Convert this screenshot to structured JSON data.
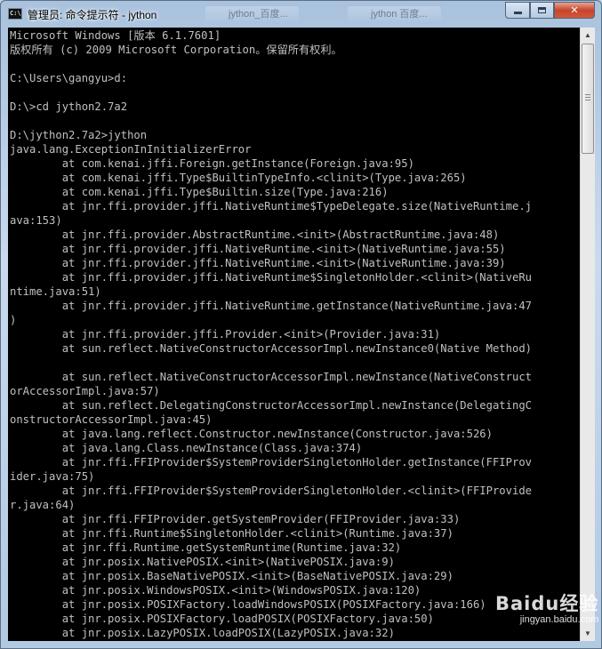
{
  "window": {
    "title": "管理员: 命令提示符 - jython",
    "app_icon_text": "C:\\",
    "background_tabs": [
      "jython_百度...",
      "jython 百度..."
    ]
  },
  "console": {
    "lines": [
      "Microsoft Windows [版本 6.1.7601]",
      "版权所有 (c) 2009 Microsoft Corporation。保留所有权利。",
      "",
      "C:\\Users\\gangyu>d:",
      "",
      "D:\\>cd jython2.7a2",
      "",
      "D:\\jython2.7a2>jython",
      "java.lang.ExceptionInInitializerError",
      "        at com.kenai.jffi.Foreign.getInstance(Foreign.java:95)",
      "        at com.kenai.jffi.Type$BuiltinTypeInfo.<clinit>(Type.java:265)",
      "        at com.kenai.jffi.Type$Builtin.size(Type.java:216)",
      "        at jnr.ffi.provider.jffi.NativeRuntime$TypeDelegate.size(NativeRuntime.j",
      "ava:153)",
      "        at jnr.ffi.provider.AbstractRuntime.<init>(AbstractRuntime.java:48)",
      "        at jnr.ffi.provider.jffi.NativeRuntime.<init>(NativeRuntime.java:55)",
      "        at jnr.ffi.provider.jffi.NativeRuntime.<init>(NativeRuntime.java:39)",
      "        at jnr.ffi.provider.jffi.NativeRuntime$SingletonHolder.<clinit>(NativeRu",
      "ntime.java:51)",
      "        at jnr.ffi.provider.jffi.NativeRuntime.getInstance(NativeRuntime.java:47",
      ")",
      "        at jnr.ffi.provider.jffi.Provider.<init>(Provider.java:31)",
      "        at sun.reflect.NativeConstructorAccessorImpl.newInstance0(Native Method)",
      "",
      "        at sun.reflect.NativeConstructorAccessorImpl.newInstance(NativeConstruct",
      "orAccessorImpl.java:57)",
      "        at sun.reflect.DelegatingConstructorAccessorImpl.newInstance(DelegatingC",
      "onstructorAccessorImpl.java:45)",
      "        at java.lang.reflect.Constructor.newInstance(Constructor.java:526)",
      "        at java.lang.Class.newInstance(Class.java:374)",
      "        at jnr.ffi.FFIProvider$SystemProviderSingletonHolder.getInstance(FFIProv",
      "ider.java:75)",
      "        at jnr.ffi.FFIProvider$SystemProviderSingletonHolder.<clinit>(FFIProvide",
      "r.java:64)",
      "        at jnr.ffi.FFIProvider.getSystemProvider(FFIProvider.java:33)",
      "        at jnr.ffi.Runtime$SingletonHolder.<clinit>(Runtime.java:37)",
      "        at jnr.ffi.Runtime.getSystemRuntime(Runtime.java:32)",
      "        at jnr.posix.NativePOSIX.<init>(NativePOSIX.java:9)",
      "        at jnr.posix.BaseNativePOSIX.<init>(BaseNativePOSIX.java:29)",
      "        at jnr.posix.WindowsPOSIX.<init>(WindowsPOSIX.java:120)",
      "        at jnr.posix.POSIXFactory.loadWindowsPOSIX(POSIXFactory.java:166)",
      "        at jnr.posix.POSIXFactory.loadPOSIX(POSIXFactory.java:50)",
      "        at jnr.posix.LazyPOSIX.loadPOSIX(LazyPOSIX.java:32)"
    ]
  },
  "watermark": {
    "logo": "Baidu经验",
    "url": "jingyan.baidu.com"
  },
  "icons": {
    "minimize": "minimize-icon",
    "maximize": "maximize-icon",
    "close": "close-icon",
    "scroll_up": "scroll-up-icon",
    "scroll_down": "scroll-down-icon"
  },
  "colors": {
    "console_bg": "#000000",
    "console_text": "#c0c0c0",
    "close_button": "#c7452b"
  }
}
